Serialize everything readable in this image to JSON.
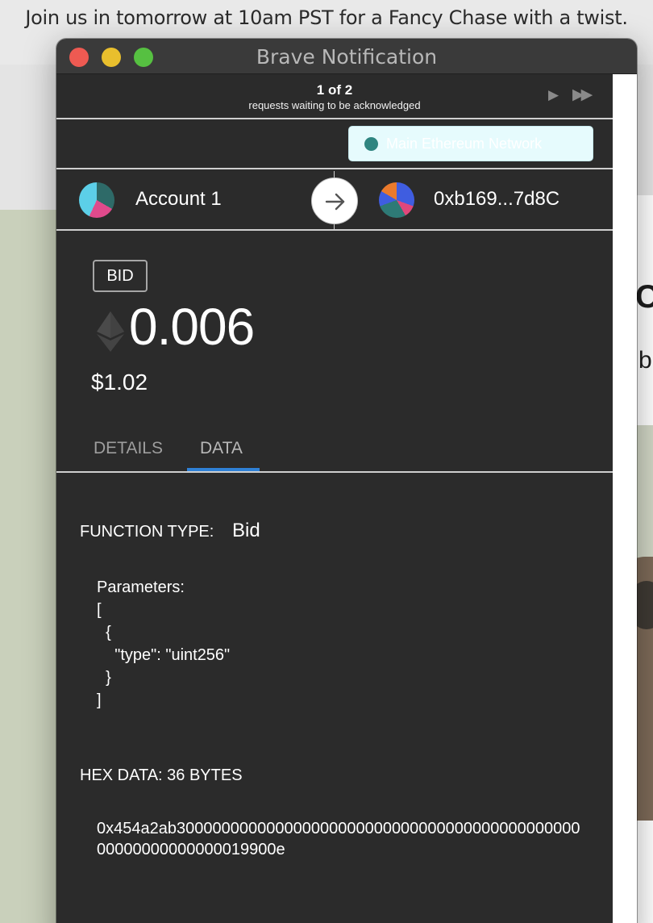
{
  "background_page": {
    "banner_text": "Join us in tomorrow at 10am PST for a Fancy Chase with a twist.",
    "partial_letter_1": "C",
    "partial_letter_2": "b"
  },
  "window": {
    "title": "Brave Notification"
  },
  "queue": {
    "count": "1 of 2",
    "subtitle": "requests waiting to be acknowledged"
  },
  "network": {
    "name": "Main Ethereum Network",
    "dot_color": "#2f8580"
  },
  "accounts": {
    "from_name": "Account 1",
    "to_address": "0xb169...7d8C"
  },
  "transaction": {
    "method": "BID",
    "amount": "0.006",
    "fiat": "$1.02"
  },
  "tabs": {
    "details": "DETAILS",
    "data": "DATA",
    "active": "data",
    "active_color": "#2f81d6"
  },
  "data": {
    "function_type_label": "FUNCTION TYPE:",
    "function_type_value": "Bid",
    "parameters": "Parameters:\n[\n  {\n    \"type\": \"uint256\"\n  }\n]",
    "hex_label": "HEX DATA: 36 BYTES",
    "hex_value": "0x454a2ab30000000000000000000000000000000000000000000000000000000000019900e"
  }
}
